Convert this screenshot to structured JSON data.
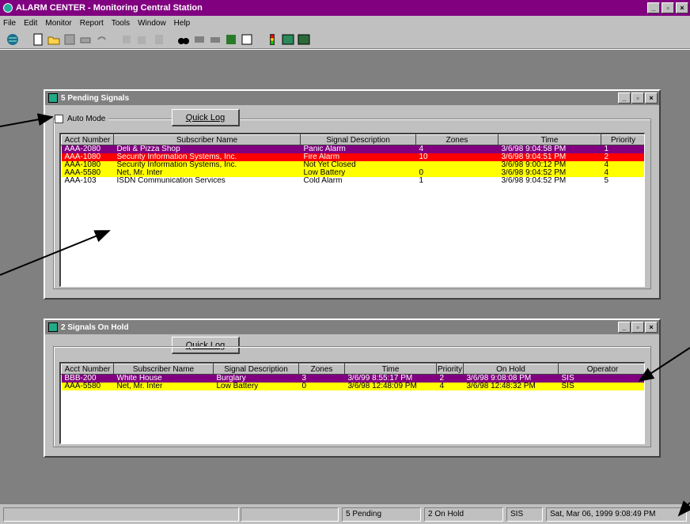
{
  "window": {
    "title": "ALARM CENTER - Monitoring Central Station"
  },
  "menu": [
    "File",
    "Edit",
    "Monitor",
    "Report",
    "Tools",
    "Window",
    "Help"
  ],
  "pending": {
    "title": "5 Pending Signals",
    "auto_mode_label": "Auto Mode",
    "quick_log_label": "Quick Log",
    "columns": [
      "Acct Number",
      "Subscriber Name",
      "Signal Description",
      "Zones",
      "Time",
      "Priority"
    ],
    "rows": [
      {
        "style": "purple",
        "cells": [
          "AAA-2080",
          "Deli & Pizza Shop",
          "Panic Alarm",
          "4",
          "3/6/98 9:04:58 PM",
          "1"
        ]
      },
      {
        "style": "red",
        "cells": [
          "AAA-1080",
          "Security Information Systems, Inc.",
          "Fire Alarm",
          "10",
          "3/6/98 9:04:51 PM",
          "2"
        ]
      },
      {
        "style": "yellow",
        "cells": [
          "AAA-1080",
          "Security Information Systems, Inc.",
          "Not Yet Closed",
          "",
          "3/6/98 9:00:12 PM",
          "4"
        ]
      },
      {
        "style": "yellow",
        "cells": [
          "AAA-5580",
          "Net, Mr. Inter",
          "Low Battery",
          "0",
          "3/6/98 9:04:52 PM",
          "4"
        ]
      },
      {
        "style": "white",
        "cells": [
          "AAA-103",
          "ISDN Communication Services",
          "Cold Alarm",
          "1",
          "3/6/98 9:04:52 PM",
          "5"
        ]
      }
    ]
  },
  "onhold": {
    "title": "2 Signals On Hold",
    "quick_log_label": "Quick Log",
    "columns": [
      "Acct Number",
      "Subscriber Name",
      "Signal Description",
      "Zones",
      "Time",
      "Priority",
      "On Hold",
      "Operator"
    ],
    "rows": [
      {
        "style": "purple",
        "cells": [
          "BBB-200",
          "White House",
          "Burglary",
          "3",
          "3/6/99 8:55:17 PM",
          "2",
          "3/6/98 9:08:08 PM",
          "SIS"
        ]
      },
      {
        "style": "yellow",
        "cells": [
          "AAA-5580",
          "Net, Mr. Inter",
          "Low Battery",
          "0",
          "3/6/98 12:48:09 PM",
          "4",
          "3/6/98 12:48:32 PM",
          "SIS"
        ]
      }
    ]
  },
  "status": {
    "pending": "5 Pending",
    "onhold": "2 On Hold",
    "user": "SIS",
    "datetime": "Sat, Mar 06, 1999  9:08:49 PM"
  },
  "colors": {
    "title": "#800080",
    "purple_row": "#800080",
    "red_row": "#ff0000",
    "yellow_row": "#ffff00",
    "desktop": "#808080"
  }
}
